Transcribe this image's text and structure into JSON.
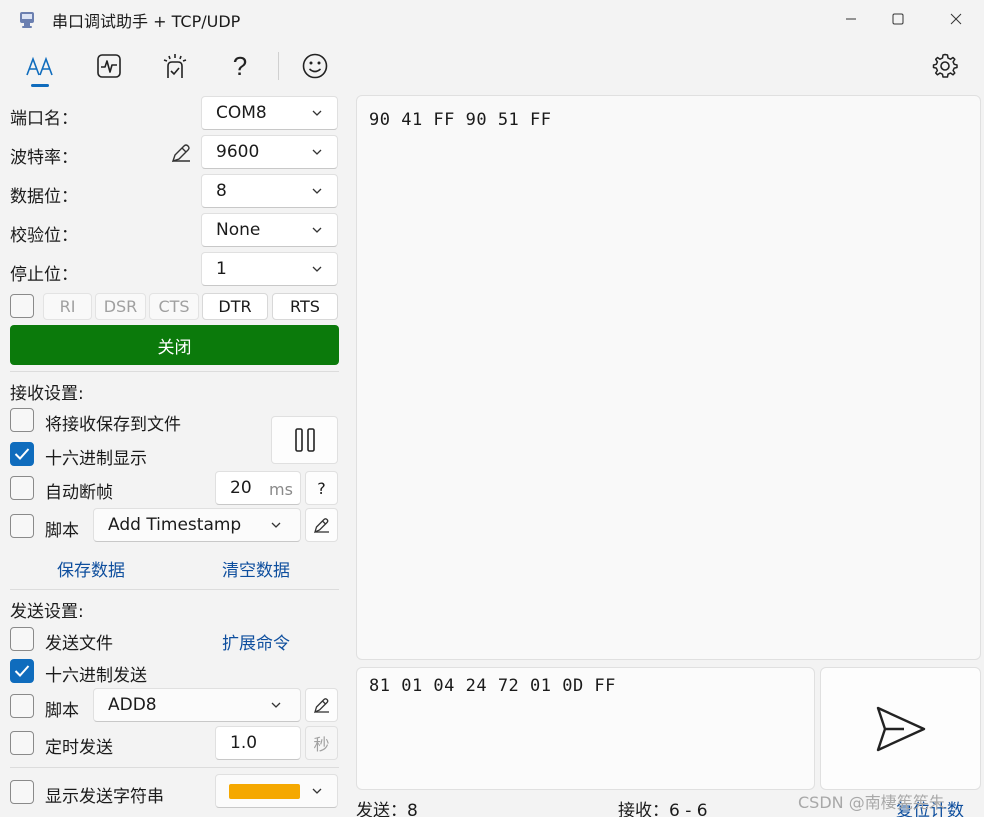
{
  "window": {
    "title": "串口调试助手 + TCP/UDP",
    "icon": "serial-port-icon"
  },
  "toolbar": {
    "icons": [
      "text-format-icon",
      "waveform-icon",
      "scene-icon",
      "help-icon",
      "smiley-icon",
      "gear-icon"
    ],
    "help_label": "?"
  },
  "serial": {
    "port_label": "端口名：",
    "port_value": "COM8",
    "baud_label": "波特率：",
    "baud_value": "9600",
    "databits_label": "数据位：",
    "databits_value": "8",
    "parity_label": "校验位：",
    "parity_value": "None",
    "stopbits_label": "停止位：",
    "stopbits_value": "1",
    "signals": [
      "RI",
      "DSR",
      "CTS",
      "DTR",
      "RTS"
    ],
    "close_label": "关闭",
    "close_color": "#0b7a0b"
  },
  "receive": {
    "section_label": "接收设置:",
    "save_to_file": {
      "label": "将接收保存到文件",
      "checked": false
    },
    "hex_display": {
      "label": "十六进制显示",
      "checked": true
    },
    "auto_frame": {
      "label": "自动断帧",
      "checked": false,
      "value": "20",
      "unit": "ms",
      "help": "?"
    },
    "script": {
      "label": "脚本",
      "checked": false,
      "value": "Add Timestamp"
    },
    "save_data": "保存数据",
    "clear_data": "清空数据",
    "content": "90 41 FF 90 51 FF"
  },
  "send": {
    "section_label": "发送设置:",
    "send_file": {
      "label": "发送文件",
      "checked": false
    },
    "ext_cmd": "扩展命令",
    "hex_send": {
      "label": "十六进制发送",
      "checked": true
    },
    "script": {
      "label": "脚本",
      "checked": false,
      "value": "ADD8"
    },
    "timed_send": {
      "label": "定时发送",
      "checked": false,
      "value": "1.0",
      "unit": "秒"
    },
    "show_string": {
      "label": "显示发送字符串",
      "checked": false,
      "color": "#f5a800"
    },
    "content": "81 01 04 24 72 01 0D FF"
  },
  "status": {
    "sent_label": "发送：8",
    "recv_label": "接收：6 - 6",
    "reset_label": "复位计数",
    "watermark": "CSDN @南棲筅筅朱"
  },
  "colors": {
    "accent": "#0f6cbd",
    "link": "#0f4f9e"
  }
}
